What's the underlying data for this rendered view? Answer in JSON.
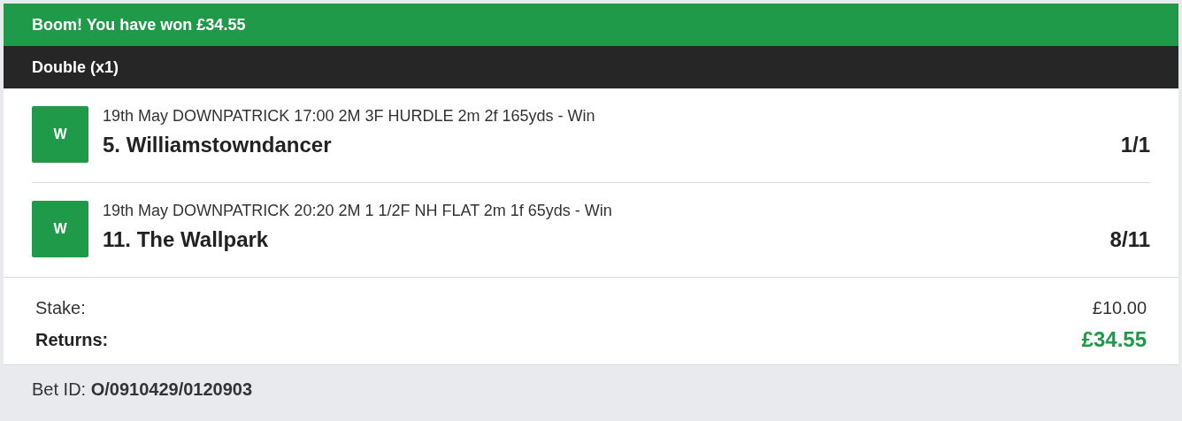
{
  "banner": {
    "text": "Boom! You have won £34.55"
  },
  "bet_type": "Double (x1)",
  "legs": [
    {
      "result": "W",
      "event": "19th May DOWNPATRICK 17:00 2M 3F HURDLE 2m 2f 165yds - Win",
      "selection": "5. Williamstowndancer",
      "odds": "1/1"
    },
    {
      "result": "W",
      "event": "19th May DOWNPATRICK 20:20 2M 1 1/2F NH FLAT 2m 1f 65yds - Win",
      "selection": "11. The Wallpark",
      "odds": "8/11"
    }
  ],
  "summary": [
    {
      "kind": "stake",
      "label": "Stake:",
      "value": "£10.00"
    },
    {
      "kind": "returns",
      "label": "Returns:",
      "value": "£34.55"
    }
  ],
  "bet_id": "Bet ID: **O/0910429/0120903**"
}
